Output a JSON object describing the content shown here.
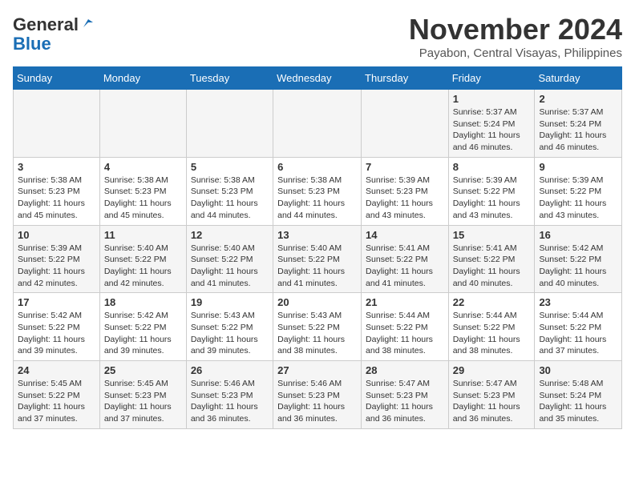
{
  "header": {
    "logo_general": "General",
    "logo_blue": "Blue",
    "month_title": "November 2024",
    "location": "Payabon, Central Visayas, Philippines"
  },
  "days_of_week": [
    "Sunday",
    "Monday",
    "Tuesday",
    "Wednesday",
    "Thursday",
    "Friday",
    "Saturday"
  ],
  "weeks": [
    {
      "days": [
        {
          "num": "",
          "info": ""
        },
        {
          "num": "",
          "info": ""
        },
        {
          "num": "",
          "info": ""
        },
        {
          "num": "",
          "info": ""
        },
        {
          "num": "",
          "info": ""
        },
        {
          "num": "1",
          "info": "Sunrise: 5:37 AM\nSunset: 5:24 PM\nDaylight: 11 hours and 46 minutes."
        },
        {
          "num": "2",
          "info": "Sunrise: 5:37 AM\nSunset: 5:24 PM\nDaylight: 11 hours and 46 minutes."
        }
      ]
    },
    {
      "days": [
        {
          "num": "3",
          "info": "Sunrise: 5:38 AM\nSunset: 5:23 PM\nDaylight: 11 hours and 45 minutes."
        },
        {
          "num": "4",
          "info": "Sunrise: 5:38 AM\nSunset: 5:23 PM\nDaylight: 11 hours and 45 minutes."
        },
        {
          "num": "5",
          "info": "Sunrise: 5:38 AM\nSunset: 5:23 PM\nDaylight: 11 hours and 44 minutes."
        },
        {
          "num": "6",
          "info": "Sunrise: 5:38 AM\nSunset: 5:23 PM\nDaylight: 11 hours and 44 minutes."
        },
        {
          "num": "7",
          "info": "Sunrise: 5:39 AM\nSunset: 5:23 PM\nDaylight: 11 hours and 43 minutes."
        },
        {
          "num": "8",
          "info": "Sunrise: 5:39 AM\nSunset: 5:22 PM\nDaylight: 11 hours and 43 minutes."
        },
        {
          "num": "9",
          "info": "Sunrise: 5:39 AM\nSunset: 5:22 PM\nDaylight: 11 hours and 43 minutes."
        }
      ]
    },
    {
      "days": [
        {
          "num": "10",
          "info": "Sunrise: 5:39 AM\nSunset: 5:22 PM\nDaylight: 11 hours and 42 minutes."
        },
        {
          "num": "11",
          "info": "Sunrise: 5:40 AM\nSunset: 5:22 PM\nDaylight: 11 hours and 42 minutes."
        },
        {
          "num": "12",
          "info": "Sunrise: 5:40 AM\nSunset: 5:22 PM\nDaylight: 11 hours and 41 minutes."
        },
        {
          "num": "13",
          "info": "Sunrise: 5:40 AM\nSunset: 5:22 PM\nDaylight: 11 hours and 41 minutes."
        },
        {
          "num": "14",
          "info": "Sunrise: 5:41 AM\nSunset: 5:22 PM\nDaylight: 11 hours and 41 minutes."
        },
        {
          "num": "15",
          "info": "Sunrise: 5:41 AM\nSunset: 5:22 PM\nDaylight: 11 hours and 40 minutes."
        },
        {
          "num": "16",
          "info": "Sunrise: 5:42 AM\nSunset: 5:22 PM\nDaylight: 11 hours and 40 minutes."
        }
      ]
    },
    {
      "days": [
        {
          "num": "17",
          "info": "Sunrise: 5:42 AM\nSunset: 5:22 PM\nDaylight: 11 hours and 39 minutes."
        },
        {
          "num": "18",
          "info": "Sunrise: 5:42 AM\nSunset: 5:22 PM\nDaylight: 11 hours and 39 minutes."
        },
        {
          "num": "19",
          "info": "Sunrise: 5:43 AM\nSunset: 5:22 PM\nDaylight: 11 hours and 39 minutes."
        },
        {
          "num": "20",
          "info": "Sunrise: 5:43 AM\nSunset: 5:22 PM\nDaylight: 11 hours and 38 minutes."
        },
        {
          "num": "21",
          "info": "Sunrise: 5:44 AM\nSunset: 5:22 PM\nDaylight: 11 hours and 38 minutes."
        },
        {
          "num": "22",
          "info": "Sunrise: 5:44 AM\nSunset: 5:22 PM\nDaylight: 11 hours and 38 minutes."
        },
        {
          "num": "23",
          "info": "Sunrise: 5:44 AM\nSunset: 5:22 PM\nDaylight: 11 hours and 37 minutes."
        }
      ]
    },
    {
      "days": [
        {
          "num": "24",
          "info": "Sunrise: 5:45 AM\nSunset: 5:22 PM\nDaylight: 11 hours and 37 minutes."
        },
        {
          "num": "25",
          "info": "Sunrise: 5:45 AM\nSunset: 5:23 PM\nDaylight: 11 hours and 37 minutes."
        },
        {
          "num": "26",
          "info": "Sunrise: 5:46 AM\nSunset: 5:23 PM\nDaylight: 11 hours and 36 minutes."
        },
        {
          "num": "27",
          "info": "Sunrise: 5:46 AM\nSunset: 5:23 PM\nDaylight: 11 hours and 36 minutes."
        },
        {
          "num": "28",
          "info": "Sunrise: 5:47 AM\nSunset: 5:23 PM\nDaylight: 11 hours and 36 minutes."
        },
        {
          "num": "29",
          "info": "Sunrise: 5:47 AM\nSunset: 5:23 PM\nDaylight: 11 hours and 36 minutes."
        },
        {
          "num": "30",
          "info": "Sunrise: 5:48 AM\nSunset: 5:24 PM\nDaylight: 11 hours and 35 minutes."
        }
      ]
    }
  ]
}
